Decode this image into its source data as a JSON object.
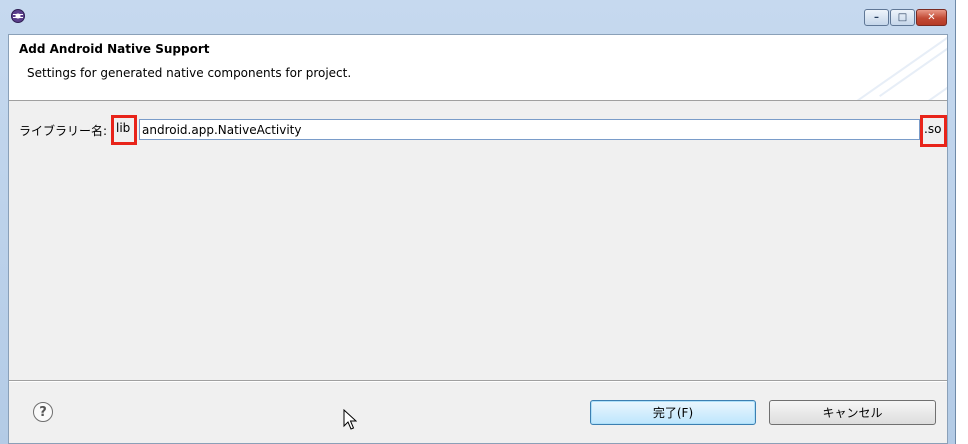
{
  "window": {
    "caption_buttons": {
      "minimize": "–",
      "maximize": "□",
      "close": "✕"
    }
  },
  "header": {
    "title": "Add Android Native Support",
    "description": "Settings for generated native components for project."
  },
  "form": {
    "library_label": "ライブラリー名:",
    "prefix": "lib",
    "library_name_value": "android.app.NativeActivity",
    "suffix": ".so"
  },
  "footer": {
    "help_symbol": "?",
    "finish_label": "完了(F)",
    "cancel_label": "キャンセル"
  },
  "icons": [
    "eclipse-icon",
    "help-icon",
    "mouse-cursor-icon"
  ],
  "colors": {
    "highlight": "#e8241a",
    "titlebar": "#c6d9ef",
    "default_button_border": "#3c7fb1"
  }
}
